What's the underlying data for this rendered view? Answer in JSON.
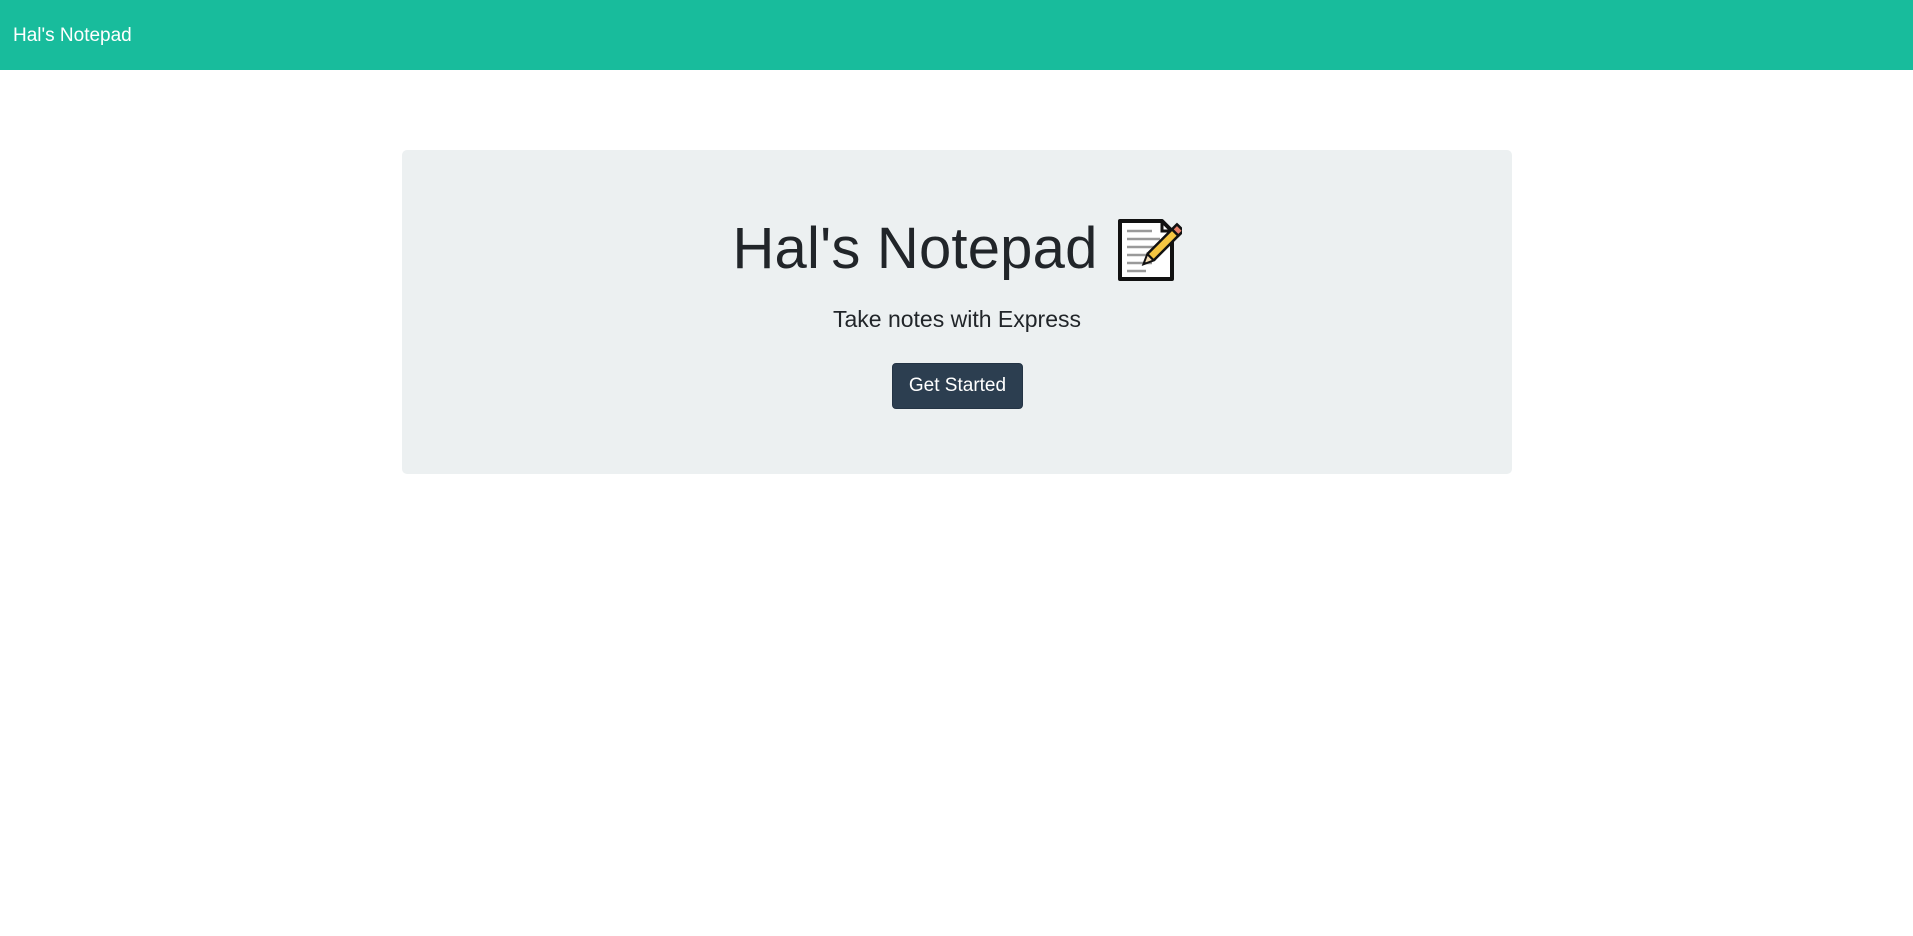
{
  "navbar": {
    "brand": "Hal's Notepad",
    "background_color": "#18bc9c"
  },
  "hero": {
    "title": "Hal's Notepad",
    "title_icon": "memo-icon",
    "subtitle": "Take notes with Express",
    "cta_label": "Get Started",
    "background_color": "#ecf0f1",
    "button_color": "#2c3e50"
  }
}
